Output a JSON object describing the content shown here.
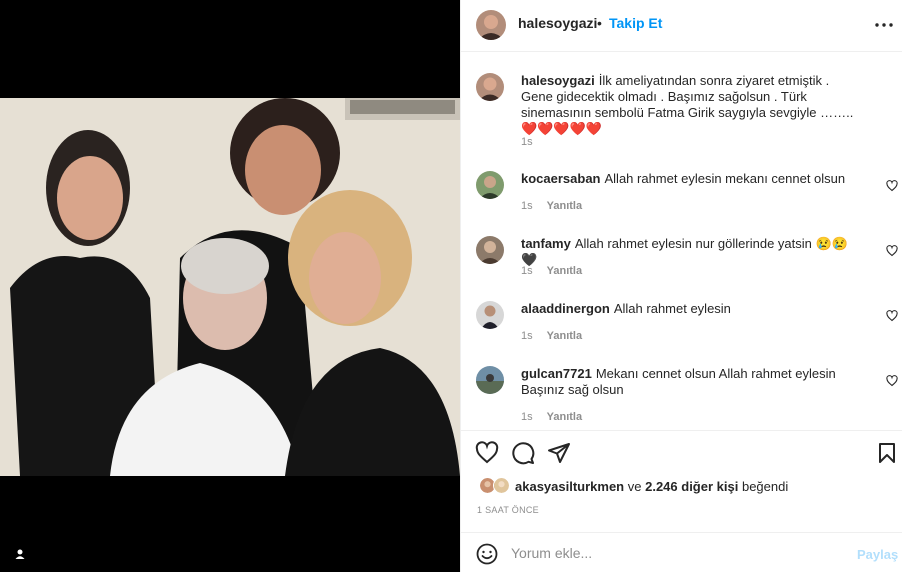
{
  "post": {
    "username": "halesoygazi",
    "separator": "•",
    "follow_label": "Takip Et",
    "more_icon": "more-horizontal-icon"
  },
  "caption": {
    "username": "halesoygazi",
    "text": "İlk ameliyatından sonra ziyaret etmiştik . Gene gidecektik olmadı . Başımız sağolsun . Türk sinemasının sembolü Fatma Girik saygıyla sevgiyle ……..",
    "hearts": "❤️❤️❤️❤️❤️",
    "time": "1s"
  },
  "comments": [
    {
      "username": "kocaersaban",
      "text": "Allah rahmet eylesin mekanı cennet olsun",
      "time": "1s",
      "reply": "Yanıtla"
    },
    {
      "username": "tanfamy",
      "text": "Allah rahmet eylesin nur göllerinde yatsin 😢😢🖤",
      "time": "1s",
      "reply": "Yanıtla"
    },
    {
      "username": "alaaddinergon",
      "text": "Allah rahmet eylesin",
      "time": "1s",
      "reply": "Yanıtla"
    },
    {
      "username": "gulcan7721",
      "text": "Mekanı cennet olsun Allah rahmet eylesin Başınız sağ olsun",
      "time": "1s",
      "reply": "Yanıtla"
    }
  ],
  "likes": {
    "first_user": "akasyasilturkmen",
    "connector": "ve",
    "others": "2.246 diğer kişi",
    "suffix": "beğendi"
  },
  "time_ago": "1 SAAT ÖNCE",
  "comment_box": {
    "placeholder": "Yorum ekle...",
    "share_label": "Paylaş"
  },
  "colors": {
    "accent": "#0095f6",
    "share_disabled": "#b2dffc",
    "muted": "#8e8e8e"
  }
}
